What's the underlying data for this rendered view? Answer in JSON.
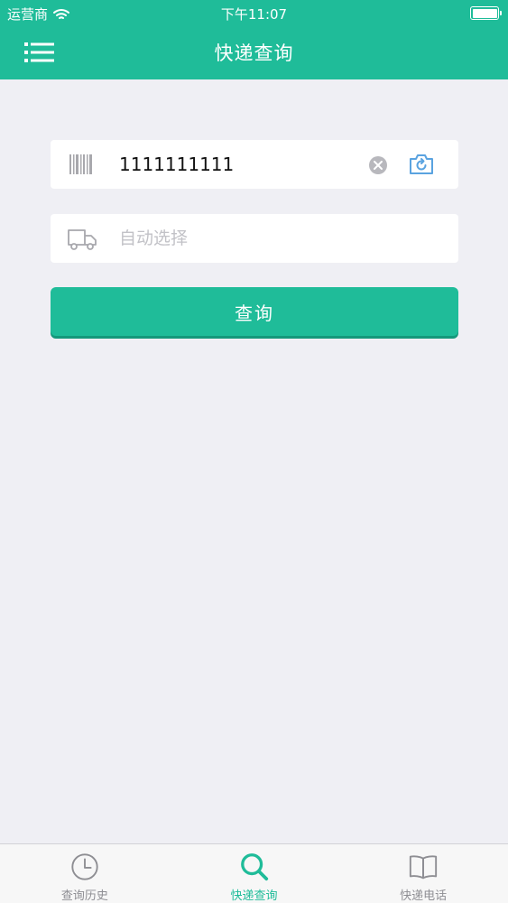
{
  "status_bar": {
    "carrier": "运营商",
    "time": "下午11:07"
  },
  "nav": {
    "title": "快递查询",
    "menu_icon": "list-menu-icon"
  },
  "form": {
    "tracking_number": "1111111111",
    "courier_placeholder": "自动选择",
    "query_label": "查询"
  },
  "tabs": [
    {
      "label": "查询历史",
      "icon": "clock-icon",
      "active": false
    },
    {
      "label": "快递查询",
      "icon": "search-icon",
      "active": true
    },
    {
      "label": "快递电话",
      "icon": "book-icon",
      "active": false
    }
  ],
  "colors": {
    "brand": "#1fbc99",
    "background": "#efeff4",
    "inactive_tab": "#8e8e93"
  }
}
